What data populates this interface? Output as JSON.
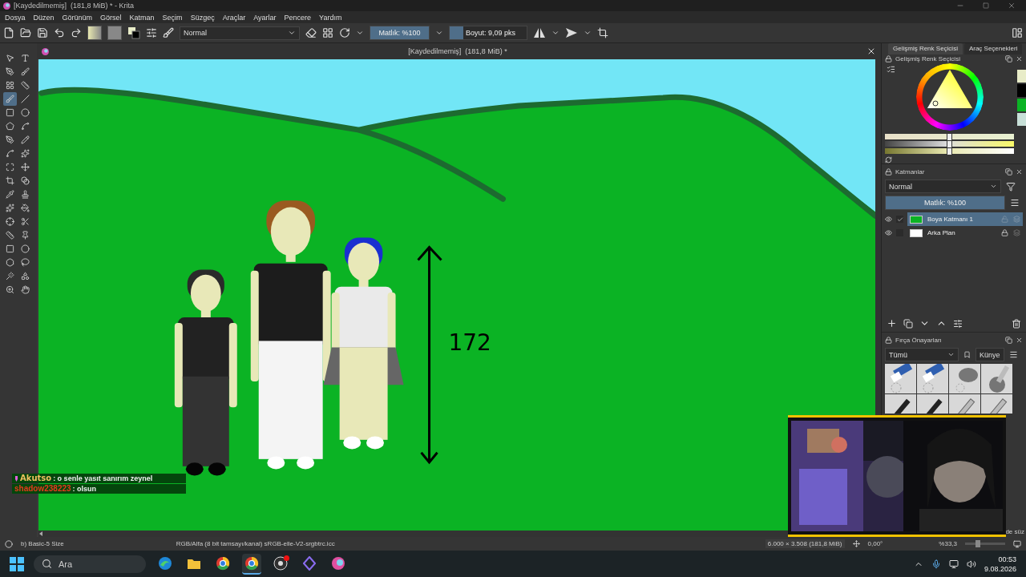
{
  "title_bar": {
    "title": "[Kaydedilmemiş]  (181,8 MiB) * - Krita"
  },
  "menu": [
    "Dosya",
    "Düzen",
    "Görünüm",
    "Görsel",
    "Katman",
    "Seçim",
    "Süzgeç",
    "Araçlar",
    "Ayarlar",
    "Pencere",
    "Yardım"
  ],
  "toolbar": {
    "blend_mode": "Normal",
    "opacity": {
      "text": "Matlık: %100",
      "level": 1
    },
    "size": {
      "text": "Boyut: 9,09 pks",
      "level": 0.18
    }
  },
  "toolbox": [
    {
      "selected": false
    },
    {
      "selected": false
    },
    {
      "selected": false
    },
    {
      "selected": false
    },
    {
      "selected": false
    },
    {
      "selected": false
    },
    {
      "selected": true
    },
    {
      "selected": false
    },
    {
      "selected": false
    },
    {
      "selected": false
    },
    {
      "selected": false
    },
    {
      "selected": false
    },
    {
      "selected": false
    },
    {
      "selected": false
    },
    {
      "selected": false
    },
    {
      "selected": false
    },
    {
      "selected": false
    },
    {
      "selected": false
    },
    {
      "selected": false
    },
    {
      "selected": false
    },
    {
      "selected": false
    },
    {
      "selected": false
    },
    {
      "selected": false
    },
    {
      "selected": false
    },
    {
      "selected": false
    },
    {
      "selected": false
    },
    {
      "selected": false
    },
    {
      "selected": false
    },
    {
      "selected": false
    },
    {
      "selected": false
    },
    {
      "selected": false
    },
    {
      "selected": false
    },
    {
      "selected": false
    },
    {
      "selected": false
    },
    {
      "selected": false
    },
    {
      "selected": false
    }
  ],
  "document": {
    "tab_title": "[Kaydedilmemiş]  (181,8 MiB) *",
    "height_label": "172"
  },
  "chat": [
    {
      "user": "Akutso",
      "color": "#f0c060",
      "text": ": o senle yasıt sanırım zeynel",
      "badge": true
    },
    {
      "user": "shadow238223",
      "color": "#e53a1c",
      "text": ": olsun",
      "badge": false
    }
  ],
  "dock": {
    "tabs": [
      {
        "label": "Gelişmiş Renk Seçicisi",
        "selected": true
      },
      {
        "label": "Araç Seçenekleri",
        "selected": false
      }
    ],
    "color_selector": {
      "title": "Gelişmiş Renk Seçicisi",
      "sliders": [
        {
          "level": 0.48
        },
        {
          "level": 0.48
        },
        {
          "level": 0.48
        }
      ],
      "swatches": [
        {
          "color": "#e8ecc8"
        },
        {
          "color": "#000000"
        },
        {
          "color": "#0bb324"
        },
        {
          "color": "#c8e0d8"
        }
      ]
    },
    "layers": {
      "title": "Katmanlar",
      "blend_mode": "Normal",
      "opacity": {
        "text": "Matlık: %100",
        "level": 1
      },
      "items": [
        {
          "name": "Boya Katmanı 1",
          "selected": true,
          "checked": true,
          "locked": false,
          "kind": "paint"
        },
        {
          "name": "Arka Plan",
          "selected": false,
          "checked": false,
          "locked": true,
          "kind": "background"
        }
      ]
    },
    "brush_presets": {
      "title": "Fırça Önayarları",
      "filter": "Tümü",
      "tag": "Künye",
      "presets": [
        {
          "kind": "eraser"
        },
        {
          "kind": "eraser"
        },
        {
          "kind": "airbrush"
        },
        {
          "kind": "ink"
        },
        {
          "kind": "pencil"
        },
        {
          "kind": "pencil"
        },
        {
          "kind": "pen"
        },
        {
          "kind": "pen"
        }
      ],
      "cut_text": "de süz"
    }
  },
  "status_bar": {
    "brush": "b) Basic-5 Size",
    "color_profile": "RGB/Alfa (8 bit tamsayı/kanal) sRGB-elle-V2-srgbtrc.icc",
    "dimensions": "6.000 × 3.508 (181,8 MiB)",
    "rotation": "0,00°",
    "zoom": "%33,3",
    "zoom_level": {
      "level": 0.3
    }
  },
  "taskbar": {
    "search": "Ara",
    "apps": [
      {
        "kind": "wave",
        "selected": false,
        "badge": false
      },
      {
        "kind": "folder",
        "selected": false,
        "badge": false
      },
      {
        "kind": "round",
        "selected": false,
        "badge": false
      },
      {
        "kind": "round",
        "selected": true,
        "badge": false
      },
      {
        "kind": "record",
        "selected": false,
        "badge": true
      },
      {
        "kind": "diamond",
        "selected": false,
        "badge": false
      },
      {
        "kind": "paint",
        "selected": false,
        "badge": false
      }
    ],
    "time": "00:53",
    "date": "9.08.2026"
  }
}
